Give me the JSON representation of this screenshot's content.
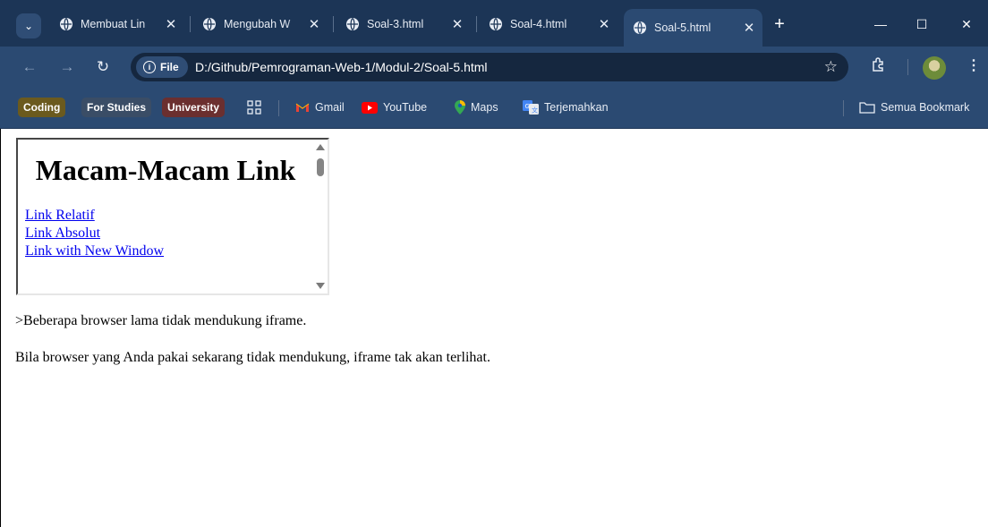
{
  "browser": {
    "tabs": [
      {
        "title": "Membuat Lin",
        "active": false
      },
      {
        "title": "Mengubah W",
        "active": false
      },
      {
        "title": "Soal-3.html",
        "active": false
      },
      {
        "title": "Soal-4.html",
        "active": false
      },
      {
        "title": "Soal-5.html",
        "active": true
      }
    ],
    "new_tab_symbol": "+",
    "window_controls": {
      "minimize": "—",
      "maximize": "☐",
      "close": "✕"
    },
    "address": {
      "chip_label": "File",
      "url": "D:/Github/Pemrograman-Web-1/Modul-2/Soal-5.html"
    },
    "bookmarks": {
      "folders": [
        "Coding",
        "For Studies",
        "University"
      ],
      "items": [
        "Gmail",
        "YouTube",
        "Maps",
        "Terjemahkan"
      ],
      "all_bookmarks": "Semua Bookmark"
    },
    "colors": {
      "tabstrip": "#1c3556",
      "toolbar": "#2b4a72",
      "coding": "#6b5a1e",
      "for_studies": "#3a4d66",
      "university": "#6b2f2f"
    }
  },
  "page": {
    "iframe": {
      "heading": "Macam-Macam Link",
      "links": [
        "Link Relatif",
        "Link Absolut",
        "Link with New Window"
      ]
    },
    "noframe_text": ">Beberapa browser lama tidak mendukung iframe.",
    "note_text": "Bila browser yang Anda pakai sekarang tidak mendukung, iframe tak akan terlihat."
  }
}
